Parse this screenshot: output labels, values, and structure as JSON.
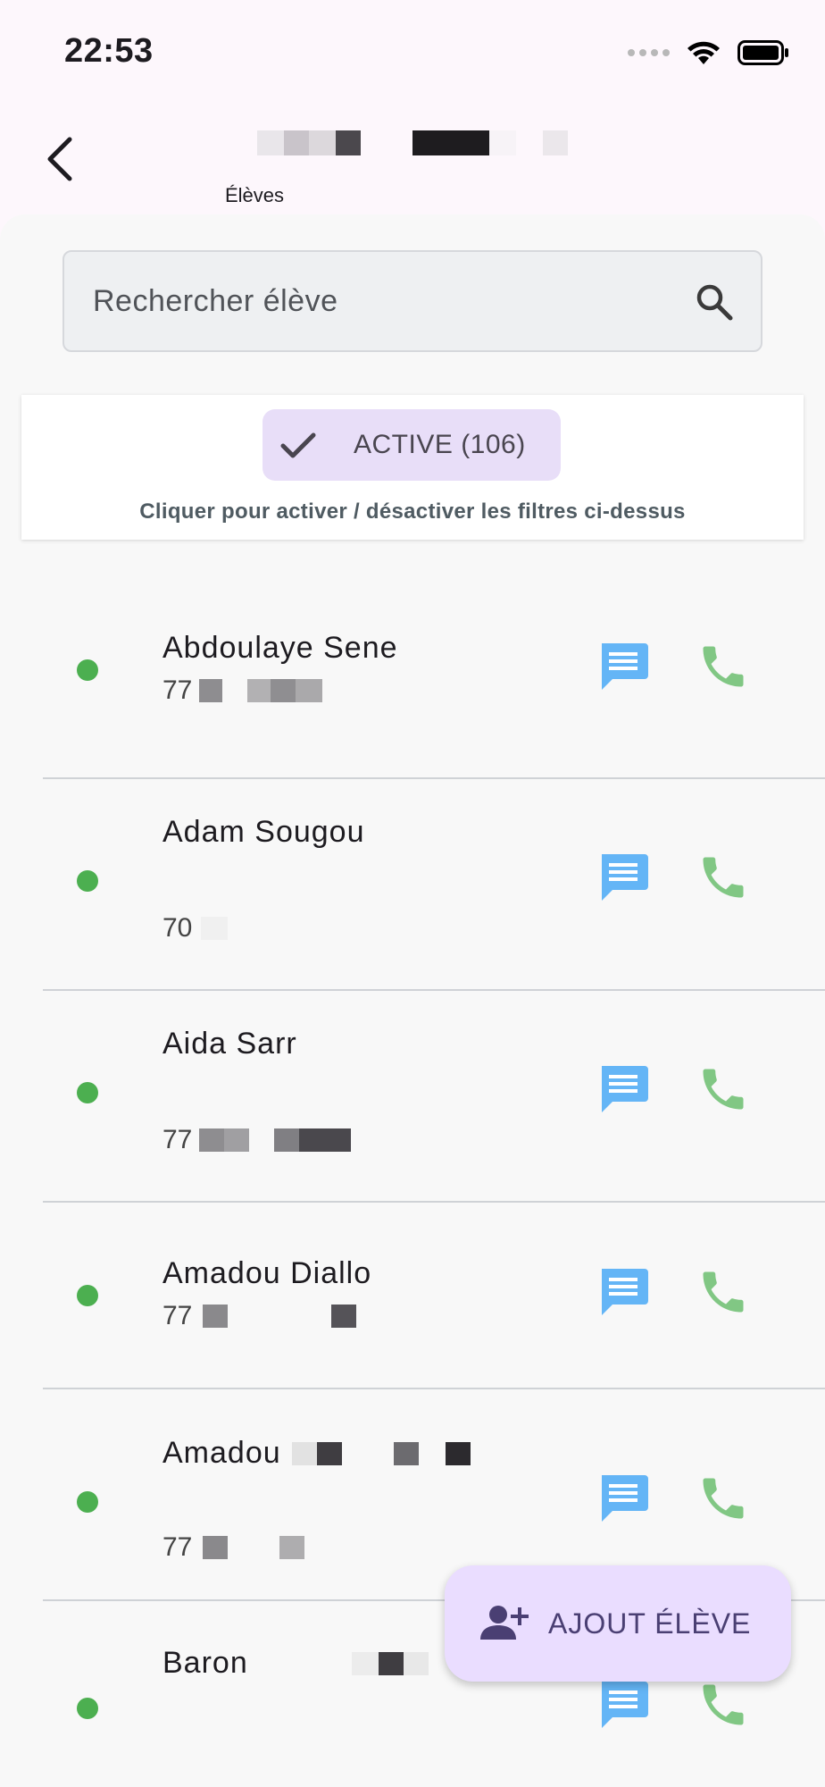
{
  "status_bar": {
    "time": "22:53"
  },
  "header": {
    "subtitle": "Élèves"
  },
  "search": {
    "placeholder": "Rechercher élève"
  },
  "filters": {
    "chip_label": "ACTIVE (106)",
    "hint": "Cliquer pour activer / désactiver les filtres ci-dessus"
  },
  "students": [
    {
      "name": "Abdoulaye Sene",
      "phone_prefix": "77",
      "status": "active"
    },
    {
      "name": "Adam Sougou",
      "phone_prefix": "70",
      "status": "active"
    },
    {
      "name": "Aida Sarr",
      "phone_prefix": "77",
      "status": "active"
    },
    {
      "name": "Amadou Diallo",
      "phone_prefix": "77",
      "status": "active"
    },
    {
      "name": "Amadou",
      "phone_prefix": "77",
      "status": "active"
    },
    {
      "name": "Baron",
      "phone_prefix": "",
      "status": "active"
    }
  ],
  "fab": {
    "label": "AJOUT ÉLÈVE"
  },
  "colors": {
    "accent": "#e8def8",
    "status_active": "#4caf50",
    "message_icon": "#64b5f6",
    "call_icon": "#81c784"
  }
}
